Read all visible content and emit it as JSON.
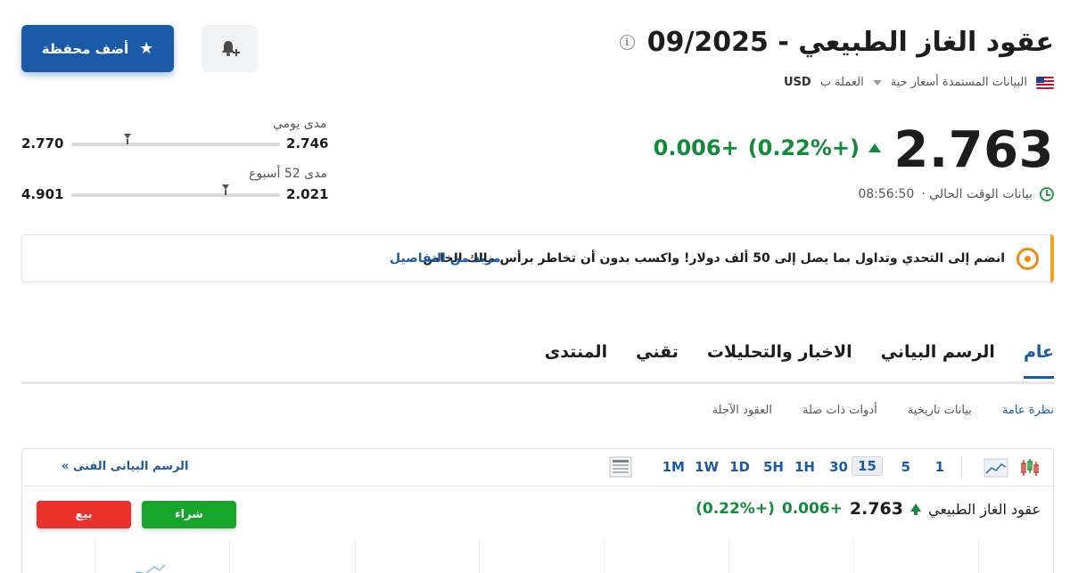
{
  "header": {
    "title": "عقود الغاز الطبيعي - 09/2025",
    "info_icon": "info-icon",
    "data_source": "البيانات المستمدة أسعار حية",
    "currency_label": "العملة ب",
    "currency": "USD"
  },
  "actions": {
    "add_portfolio": "أضف محفظة",
    "add_alert_icon": "bell-plus-icon"
  },
  "quote": {
    "price": "2.763",
    "change": "+0.006",
    "change_pct": "(+0.22%)",
    "time_label": "بيانات الوقت الحالي ·",
    "time": "08:56:50"
  },
  "ranges": {
    "daily": {
      "label": "مدى يومي",
      "low": "2.746",
      "high": "2.770",
      "position": 0.73
    },
    "week52": {
      "label": "مدى 52 أسبوع",
      "low": "2.021",
      "high": "4.901",
      "position": 0.26
    }
  },
  "promo": {
    "text": "انضم إلى التحدي وتداول بما يصل إلى 50 ألف دولار! واكسب بدون أن تخاطر برأس مالك الخاص",
    "link": "مزيد من التفاصيل"
  },
  "tabs": [
    "عام",
    "الرسم البياني",
    "الاخبار والتحليلات",
    "تقني",
    "المنتدى"
  ],
  "subtabs": [
    "نظرة عامة",
    "بيانات تاريخية",
    "أدوات ذات صلة",
    "العقود الآجلة"
  ],
  "chart": {
    "timeframes": [
      "1",
      "5",
      "15",
      "30",
      "1H",
      "5H",
      "1D",
      "1W",
      "1M"
    ],
    "active_timeframe": "15",
    "tech_chart_link": "الرسم البيانى الفنى »",
    "name": "عقود الغاز الطبيعي",
    "price": "2.763",
    "change": "+0.006",
    "change_pct": "(+0.22%)",
    "buy": "شراء",
    "sell": "بيع"
  }
}
